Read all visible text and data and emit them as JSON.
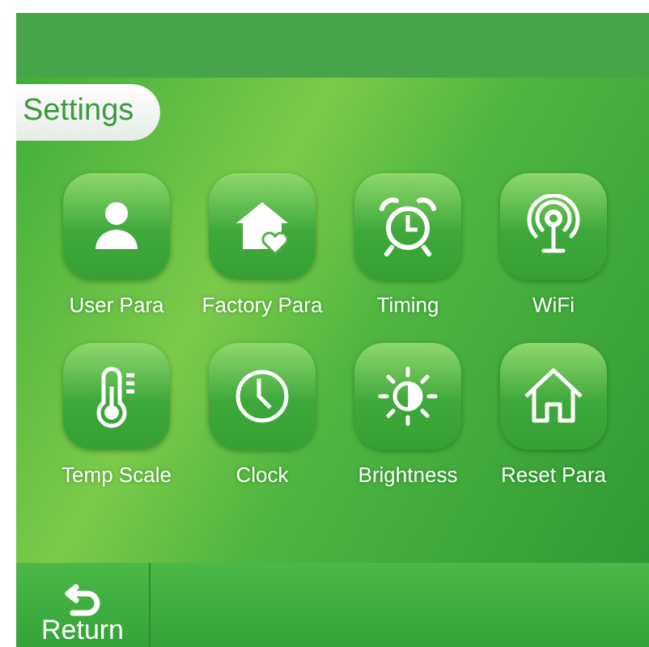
{
  "title": "Settings",
  "items": [
    {
      "label": "User Para",
      "kind": "person"
    },
    {
      "label": "Factory Para",
      "kind": "house-heart"
    },
    {
      "label": "Timing",
      "kind": "alarm"
    },
    {
      "label": "WiFi",
      "kind": "antenna"
    },
    {
      "label": "Temp Scale",
      "kind": "thermometer"
    },
    {
      "label": "Clock",
      "kind": "clock"
    },
    {
      "label": "Brightness",
      "kind": "brightness"
    },
    {
      "label": "Reset Para",
      "kind": "home"
    }
  ],
  "footer": {
    "return_label": "Return"
  }
}
